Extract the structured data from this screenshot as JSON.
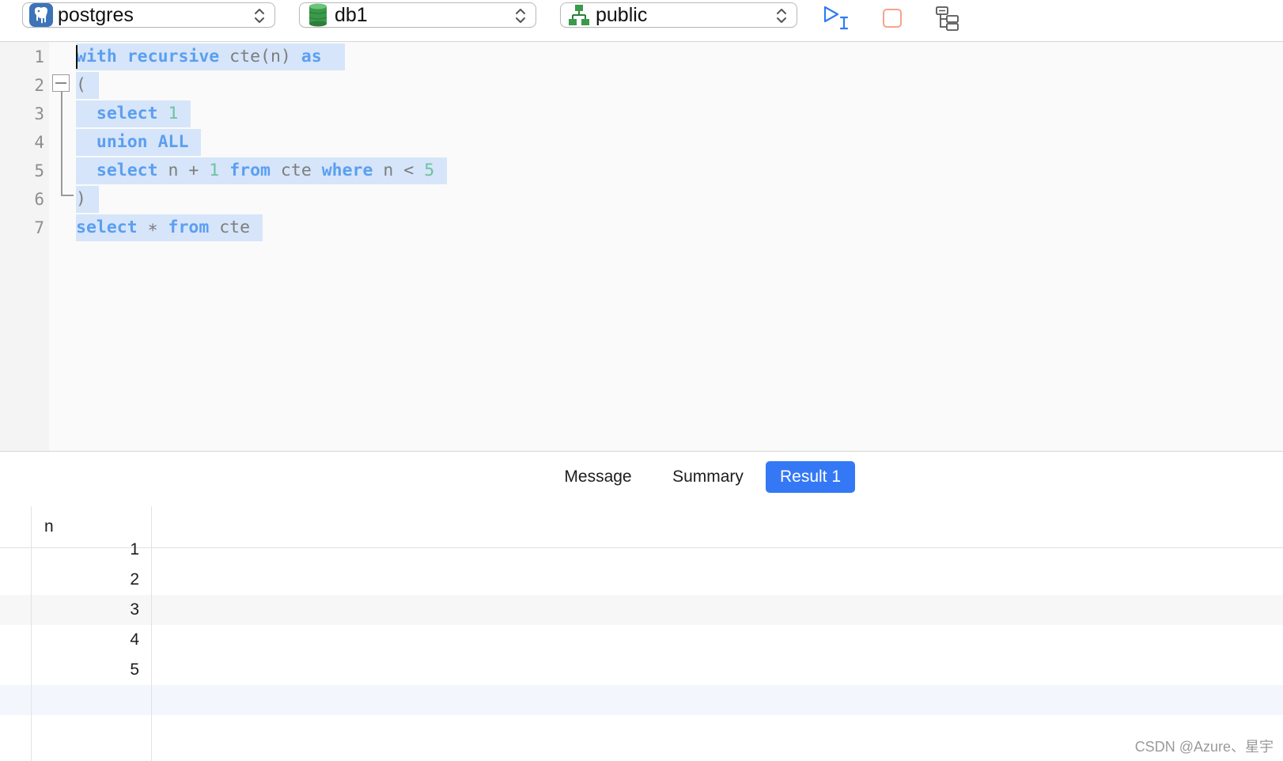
{
  "toolbar": {
    "connection": {
      "label": "postgres",
      "icon": "postgresql-elephant-icon"
    },
    "database": {
      "label": "db1",
      "icon": "database-cylinder-icon",
      "color": "#3a9a4a"
    },
    "schema": {
      "label": "public",
      "icon": "schema-hierarchy-icon",
      "color": "#3a9a4a"
    },
    "buttons": [
      {
        "name": "run-selected-button",
        "icon": "run-cursor-icon",
        "color": "#2f7cf6"
      },
      {
        "name": "stop-button",
        "icon": "stop-square-icon",
        "color": "#f3a48b"
      },
      {
        "name": "explain-button",
        "icon": "tree-structure-icon",
        "color": "#555555"
      }
    ]
  },
  "editor": {
    "line_numbers": [
      "1",
      "2",
      "3",
      "4",
      "5",
      "6",
      "7"
    ],
    "lines": [
      [
        {
          "t": "with",
          "k": "kw"
        },
        {
          "t": " "
        },
        {
          "t": "recursive",
          "k": "kw"
        },
        {
          "t": " cte(n) "
        },
        {
          "t": "as",
          "k": "kw"
        },
        {
          "t": " "
        }
      ],
      [
        {
          "t": "("
        }
      ],
      [
        {
          "t": "  "
        },
        {
          "t": "select",
          "k": "kw"
        },
        {
          "t": " "
        },
        {
          "t": "1",
          "k": "num"
        }
      ],
      [
        {
          "t": "  "
        },
        {
          "t": "union",
          "k": "kw"
        },
        {
          "t": " "
        },
        {
          "t": "ALL",
          "k": "kw"
        }
      ],
      [
        {
          "t": "  "
        },
        {
          "t": "select",
          "k": "kw"
        },
        {
          "t": " n + "
        },
        {
          "t": "1",
          "k": "num"
        },
        {
          "t": " "
        },
        {
          "t": "from",
          "k": "kw"
        },
        {
          "t": " cte "
        },
        {
          "t": "where",
          "k": "kw"
        },
        {
          "t": " n < "
        },
        {
          "t": "5",
          "k": "num"
        }
      ],
      [
        {
          "t": ")"
        }
      ],
      [
        {
          "t": "select",
          "k": "kw"
        },
        {
          "t": " ∗ "
        },
        {
          "t": "from",
          "k": "kw"
        },
        {
          "t": " cte"
        }
      ]
    ]
  },
  "result_tabs": [
    {
      "label": "Message",
      "active": false
    },
    {
      "label": "Summary",
      "active": false
    },
    {
      "label": "Result 1",
      "active": true
    }
  ],
  "grid": {
    "columns": [
      "n"
    ],
    "rows": [
      "1",
      "2",
      "3",
      "4",
      "5"
    ]
  },
  "watermark": "CSDN @Azure、星宇",
  "colors": {
    "accent": "#3478f6",
    "selection": "#d6e5f9",
    "keyword": "#5b9ff0",
    "number": "#6cc3a0"
  }
}
